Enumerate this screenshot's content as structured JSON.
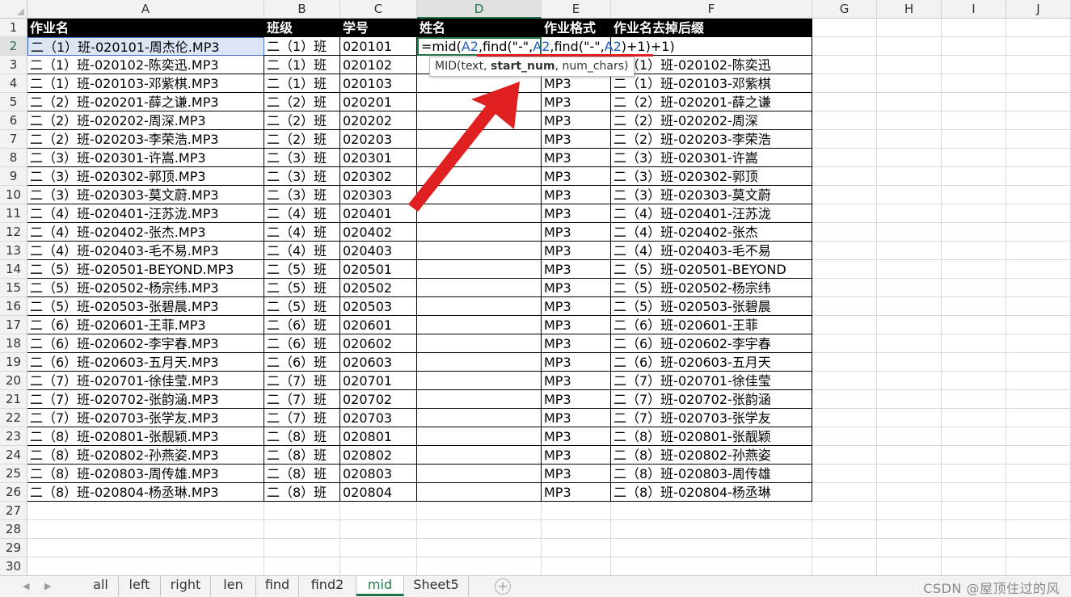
{
  "columns": [
    "A",
    "B",
    "C",
    "D",
    "E",
    "F",
    "G",
    "H",
    "I",
    "J"
  ],
  "active_column": "D",
  "row_numbers": [
    "1",
    "2",
    "3",
    "4",
    "5",
    "6",
    "7",
    "8",
    "9",
    "10",
    "11",
    "12",
    "13",
    "14",
    "15",
    "16",
    "17",
    "18",
    "19",
    "20",
    "21",
    "22",
    "23",
    "24",
    "25",
    "26",
    "27",
    "28",
    "29",
    "30"
  ],
  "active_row": "2",
  "headers": [
    "作业名",
    "班级",
    "学号",
    "姓名",
    "作业格式",
    "作业名去掉后缀"
  ],
  "rows": [
    [
      "二（1）班-020101-周杰伦.MP3",
      "二（1）班",
      "020101",
      "",
      "",
      ""
    ],
    [
      "二（1）班-020102-陈奕迅.MP3",
      "二（1）班",
      "020102",
      "",
      "",
      "二（1）班-020102-陈奕迅"
    ],
    [
      "二（1）班-020103-邓紫棋.MP3",
      "二（1）班",
      "020103",
      "",
      "MP3",
      "二（1）班-020103-邓紫棋"
    ],
    [
      "二（2）班-020201-薛之谦.MP3",
      "二（2）班",
      "020201",
      "",
      "MP3",
      "二（2）班-020201-薛之谦"
    ],
    [
      "二（2）班-020202-周深.MP3",
      "二（2）班",
      "020202",
      "",
      "MP3",
      "二（2）班-020202-周深"
    ],
    [
      "二（2）班-020203-李荣浩.MP3",
      "二（2）班",
      "020203",
      "",
      "MP3",
      "二（2）班-020203-李荣浩"
    ],
    [
      "二（3）班-020301-许嵩.MP3",
      "二（3）班",
      "020301",
      "",
      "MP3",
      "二（3）班-020301-许嵩"
    ],
    [
      "二（3）班-020302-郭顶.MP3",
      "二（3）班",
      "020302",
      "",
      "MP3",
      "二（3）班-020302-郭顶"
    ],
    [
      "二（3）班-020303-莫文蔚.MP3",
      "二（3）班",
      "020303",
      "",
      "MP3",
      "二（3）班-020303-莫文蔚"
    ],
    [
      "二（4）班-020401-汪苏泷.MP3",
      "二（4）班",
      "020401",
      "",
      "MP3",
      "二（4）班-020401-汪苏泷"
    ],
    [
      "二（4）班-020402-张杰.MP3",
      "二（4）班",
      "020402",
      "",
      "MP3",
      "二（4）班-020402-张杰"
    ],
    [
      "二（4）班-020403-毛不易.MP3",
      "二（4）班",
      "020403",
      "",
      "MP3",
      "二（4）班-020403-毛不易"
    ],
    [
      "二（5）班-020501-BEYOND.MP3",
      "二（5）班",
      "020501",
      "",
      "MP3",
      "二（5）班-020501-BEYOND"
    ],
    [
      "二（5）班-020502-杨宗纬.MP3",
      "二（5）班",
      "020502",
      "",
      "MP3",
      "二（5）班-020502-杨宗纬"
    ],
    [
      "二（5）班-020503-张碧晨.MP3",
      "二（5）班",
      "020503",
      "",
      "MP3",
      "二（5）班-020503-张碧晨"
    ],
    [
      "二（6）班-020601-王菲.MP3",
      "二（6）班",
      "020601",
      "",
      "MP3",
      "二（6）班-020601-王菲"
    ],
    [
      "二（6）班-020602-李宇春.MP3",
      "二（6）班",
      "020602",
      "",
      "MP3",
      "二（6）班-020602-李宇春"
    ],
    [
      "二（6）班-020603-五月天.MP3",
      "二（6）班",
      "020603",
      "",
      "MP3",
      "二（6）班-020603-五月天"
    ],
    [
      "二（7）班-020701-徐佳莹.MP3",
      "二（7）班",
      "020701",
      "",
      "MP3",
      "二（7）班-020701-徐佳莹"
    ],
    [
      "二（7）班-020702-张韵涵.MP3",
      "二（7）班",
      "020702",
      "",
      "MP3",
      "二（7）班-020702-张韵涵"
    ],
    [
      "二（7）班-020703-张学友.MP3",
      "二（7）班",
      "020703",
      "",
      "MP3",
      "二（7）班-020703-张学友"
    ],
    [
      "二（8）班-020801-张靓颖.MP3",
      "二（8）班",
      "020801",
      "",
      "MP3",
      "二（8）班-020801-张靓颖"
    ],
    [
      "二（8）班-020802-孙燕姿.MP3",
      "二（8）班",
      "020802",
      "",
      "MP3",
      "二（8）班-020802-孙燕姿"
    ],
    [
      "二（8）班-020803-周传雄.MP3",
      "二（8）班",
      "020803",
      "",
      "MP3",
      "二（8）班-020803-周传雄"
    ],
    [
      "二（8）班-020804-杨丞琳.MP3",
      "二（8）班",
      "020804",
      "",
      "MP3",
      "二（8）班-020804-杨丞琳"
    ]
  ],
  "editing_formula": {
    "parts": [
      "=mid(",
      "A2",
      ",find(\"-\",",
      "A2",
      ",find(\"-\",",
      "A2",
      ")+1)+1)"
    ]
  },
  "tooltip": {
    "prefix": "MID(text, ",
    "bold": "start_num",
    "suffix": ", num_chars)"
  },
  "colors": {
    "accent": "#217346",
    "annotation": "#e02020",
    "ref_blue": "#1f5fbf"
  },
  "sheet_tabs": [
    "all",
    "left",
    "right",
    "len",
    "find",
    "find2",
    "mid",
    "Sheet5"
  ],
  "active_tab": "mid",
  "watermark": "CSDN @屋顶住过的风"
}
